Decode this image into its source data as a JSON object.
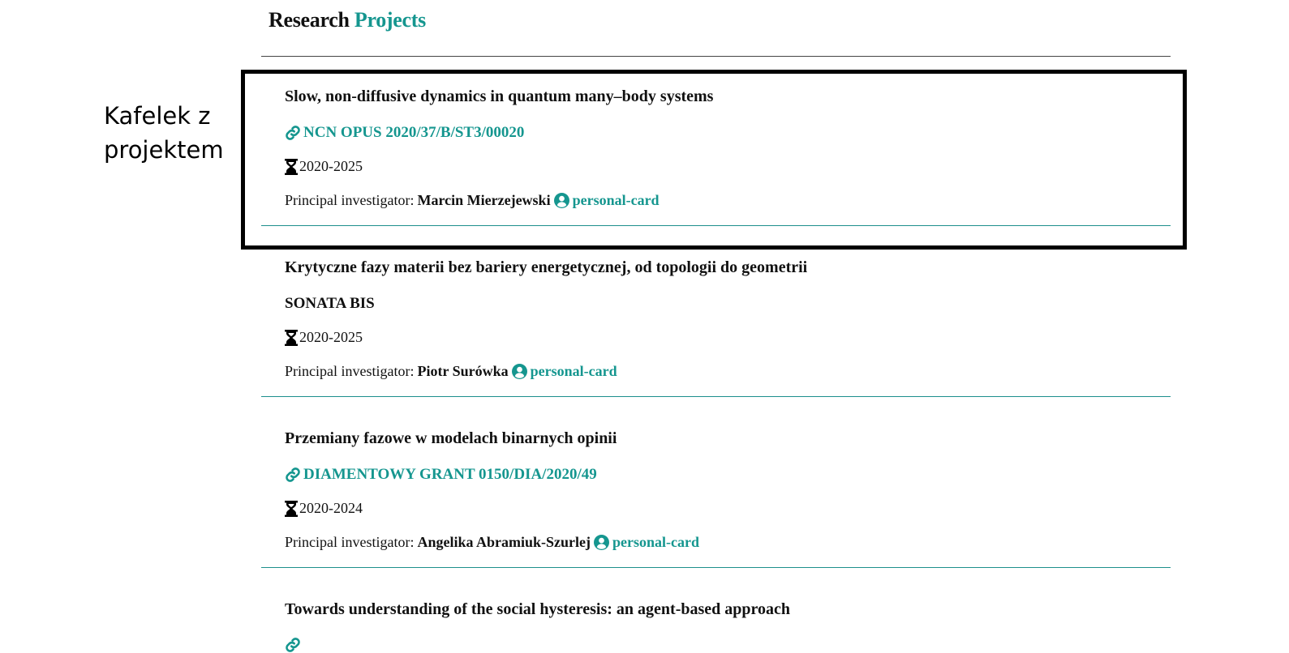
{
  "header": {
    "title_part1": "Research",
    "title_part2": "Projects"
  },
  "annotation": {
    "label": "Kafelek z projektem"
  },
  "colors": {
    "accent": "#15968f",
    "text": "#111111"
  },
  "labels": {
    "pi_prefix": "Principal investigator:",
    "personal_card": "personal-card"
  },
  "projects": [
    {
      "title": "Slow, non-diffusive dynamics in quantum many–body systems",
      "grant": "NCN OPUS 2020/37/B/ST3/00020",
      "grant_link": true,
      "dates": "2020-2025",
      "pi": "Marcin Mierzejewski"
    },
    {
      "title": "Krytyczne fazy materii bez bariery energetycznej, od topologii do geometrii",
      "grant": "SONATA BIS",
      "grant_link": false,
      "dates": "2020-2025",
      "pi": "Piotr Surówka"
    },
    {
      "title": "Przemiany fazowe w modelach binarnych opinii",
      "grant": "DIAMENTOWY GRANT 0150/DIA/2020/49",
      "grant_link": true,
      "dates": "2020-2024",
      "pi": "Angelika Abramiuk-Szurlej"
    },
    {
      "title": "Towards understanding of the social hysteresis: an agent-based approach"
    }
  ]
}
